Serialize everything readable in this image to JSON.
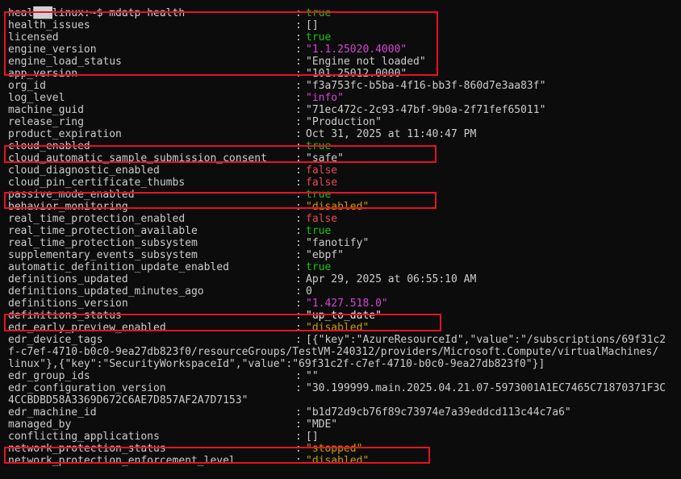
{
  "prompt": "███linux:~$ mdatp health",
  "rows": [
    {
      "k": "healthy",
      "v": "true",
      "c": "c-true"
    },
    {
      "k": "health_issues",
      "v": "[]",
      "c": "c-str"
    },
    {
      "k": "licensed",
      "v": "true",
      "c": "c-true"
    },
    {
      "k": "engine_version",
      "v": "\"1.1.25020.4000\"",
      "c": "c-ver"
    },
    {
      "k": "engine_load_status",
      "v": "\"Engine not loaded\"",
      "c": "c-str"
    },
    {
      "k": "app_version",
      "v": "\"101.25012.0000\"",
      "c": "c-str"
    },
    {
      "k": "org_id",
      "v": "\"f3a753fc-b5ba-4f16-bb3f-860d7e3aa83f\"",
      "c": "c-str"
    },
    {
      "k": "log_level",
      "v": "\"info\"",
      "c": "c-ver"
    },
    {
      "k": "machine_guid",
      "v": "\"71ec472c-2c93-47bf-9b0a-2f71fef65011\"",
      "c": "c-str"
    },
    {
      "k": "release_ring",
      "v": "\"Production\"",
      "c": "c-str"
    },
    {
      "k": "product_expiration",
      "v": "Oct 31, 2025 at 11:40:47 PM",
      "c": "c-str"
    },
    {
      "k": "cloud_enabled",
      "v": "true",
      "c": "c-true"
    },
    {
      "k": "cloud_automatic_sample_submission_consent",
      "v": "\"safe\"",
      "c": "c-str"
    },
    {
      "k": "cloud_diagnostic_enabled",
      "v": "false",
      "c": "c-false"
    },
    {
      "k": "cloud_pin_certificate_thumbs",
      "v": "false",
      "c": "c-false"
    },
    {
      "k": "passive_mode_enabled",
      "v": "true",
      "c": "c-true"
    },
    {
      "k": "behavior_monitoring",
      "v": "\"disabled\"",
      "c": "c-dis"
    },
    {
      "k": "real_time_protection_enabled",
      "v": "false",
      "c": "c-false"
    },
    {
      "k": "real_time_protection_available",
      "v": "true",
      "c": "c-true"
    },
    {
      "k": "real_time_protection_subsystem",
      "v": "\"fanotify\"",
      "c": "c-str"
    },
    {
      "k": "supplementary_events_subsystem",
      "v": "\"ebpf\"",
      "c": "c-str"
    },
    {
      "k": "automatic_definition_update_enabled",
      "v": "true",
      "c": "c-true"
    },
    {
      "k": "definitions_updated",
      "v": "Apr 29, 2025 at 06:55:10 AM",
      "c": "c-str"
    },
    {
      "k": "definitions_updated_minutes_ago",
      "v": "0",
      "c": "c-str"
    },
    {
      "k": "definitions_version",
      "v": "\"1.427.518.0\"",
      "c": "c-ver"
    },
    {
      "k": "definitions_status",
      "v": "\"up_to_date\"",
      "c": "c-up"
    },
    {
      "k": "edr_early_preview_enabled",
      "v": "\"disabled\"",
      "c": "c-dis"
    },
    {
      "k": "edr_device_tags",
      "v": "[{\"key\":\"AzureResourceId\",\"value\":\"/subscriptions/69f31c2",
      "c": "c-str"
    },
    {
      "cont": "f-c7ef-4710-b0c0-9ea27db823f0/resourceGroups/TestVM-240312/providers/Microsoft.Compute/virtualMachines/"
    },
    {
      "cont": "linux\"},{\"key\":\"SecurityWorkspaceId\",\"value\":\"69f31c2f-c7ef-4710-b0c0-9ea27db823f0\"}]"
    },
    {
      "k": "edr_group_ids",
      "v": "\"\"",
      "c": "c-str"
    },
    {
      "k": "edr_configuration_version",
      "v": "\"30.199999.main.2025.04.21.07-5973001A1EC7465C71870371F3C",
      "c": "c-str"
    },
    {
      "cont": "4CCBDBD58A3369D672C6AE7D857AF2A7D7153\""
    },
    {
      "k": "edr_machine_id",
      "v": "\"b1d72d9cb76f89c73974e7a39eddcd113c44c7a6\"",
      "c": "c-str"
    },
    {
      "k": "managed_by",
      "v": "\"MDE\"",
      "c": "c-str"
    },
    {
      "k": "conflicting_applications",
      "v": "[]",
      "c": "c-str"
    },
    {
      "k": "network_protection_status",
      "v": "\"stopped\"",
      "c": "c-dis"
    },
    {
      "k": "network_protection_enforcement_level",
      "v": "\"disabled\"",
      "c": "c-dis"
    },
    {
      "k": "",
      "v": "",
      "c": "c-str"
    }
  ],
  "separator": ":",
  "highlight_color": "#e81123"
}
